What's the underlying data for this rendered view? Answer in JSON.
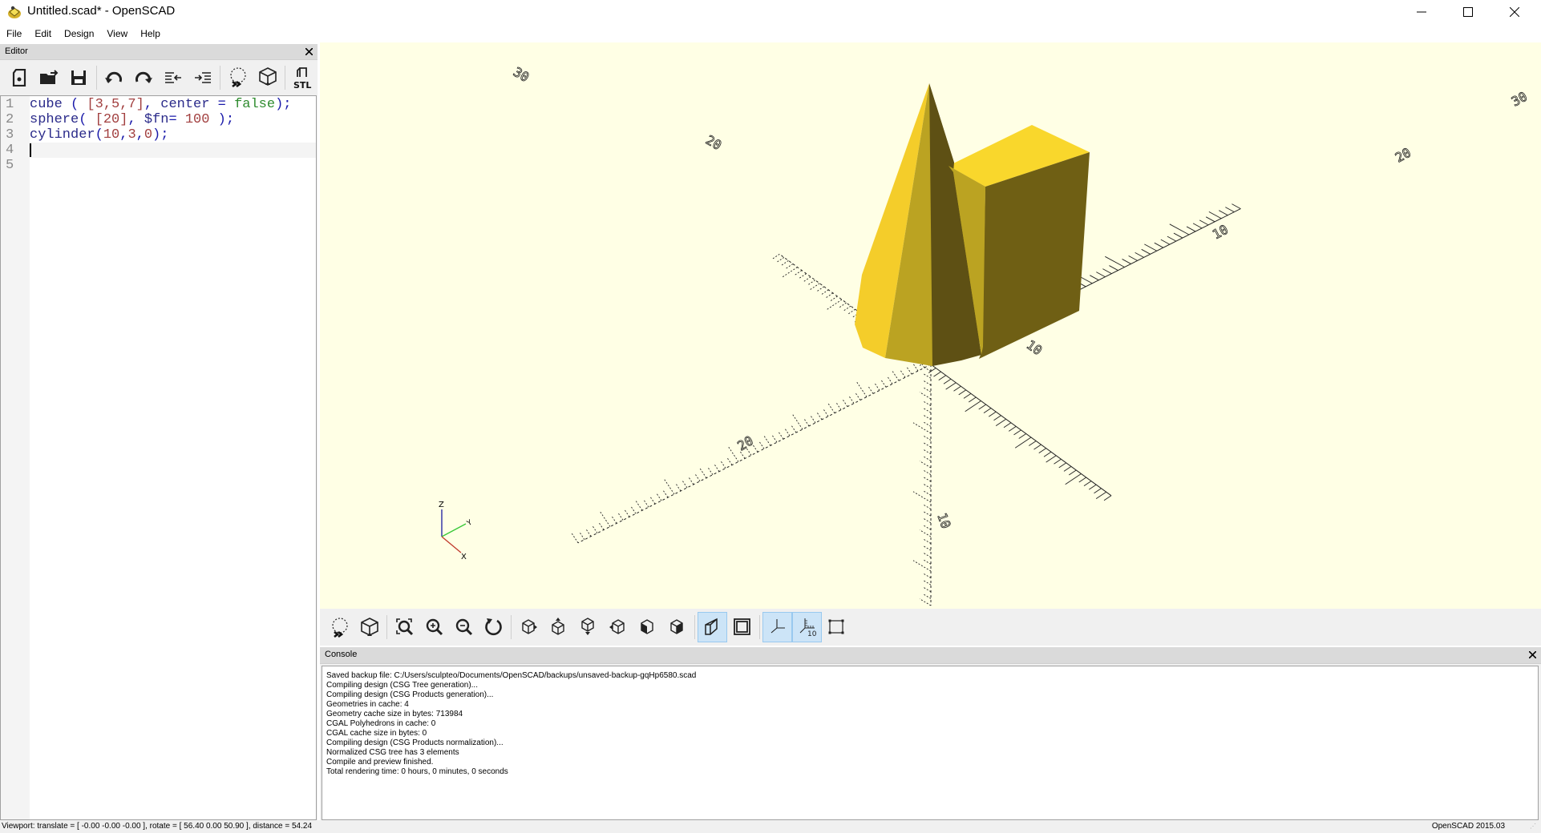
{
  "window": {
    "title": "Untitled.scad* - OpenSCAD",
    "controls": {
      "minimize": "minimize-icon",
      "maximize": "maximize-icon",
      "close": "close-icon"
    }
  },
  "menu": [
    "File",
    "Edit",
    "Design",
    "View",
    "Help"
  ],
  "editor": {
    "title": "Editor",
    "toolbar": [
      {
        "name": "new-file",
        "icon": "new-file-icon"
      },
      {
        "name": "open-file",
        "icon": "open-folder-icon"
      },
      {
        "name": "save-file",
        "icon": "save-icon"
      },
      {
        "name": "undo",
        "icon": "undo-icon"
      },
      {
        "name": "redo",
        "icon": "redo-icon"
      },
      {
        "name": "unindent",
        "icon": "unindent-icon"
      },
      {
        "name": "indent",
        "icon": "indent-icon"
      },
      {
        "name": "preview",
        "icon": "preview-icon"
      },
      {
        "name": "render",
        "icon": "render-icon"
      },
      {
        "name": "export-stl",
        "icon": "stl-export-icon",
        "label": "STL"
      }
    ],
    "lines": [
      {
        "n": "1",
        "tokens": [
          [
            "kw",
            "cube"
          ],
          [
            "punc",
            " ( "
          ],
          [
            "num",
            "[3,5,7]"
          ],
          [
            "punc",
            ", "
          ],
          [
            "kw",
            "center"
          ],
          [
            "punc",
            " = "
          ],
          [
            "bool",
            "false"
          ],
          [
            "punc",
            ");"
          ]
        ]
      },
      {
        "n": "2",
        "tokens": [
          [
            "kw",
            "sphere"
          ],
          [
            "punc",
            "( "
          ],
          [
            "num",
            "[20]"
          ],
          [
            "punc",
            ", "
          ],
          [
            "kw",
            "$fn"
          ],
          [
            "punc",
            "= "
          ],
          [
            "num",
            "100"
          ],
          [
            "punc",
            " );"
          ]
        ]
      },
      {
        "n": "3",
        "tokens": [
          [
            "kw",
            "cylinder"
          ],
          [
            "punc",
            "("
          ],
          [
            "num",
            "10"
          ],
          [
            "punc",
            ","
          ],
          [
            "num",
            "3"
          ],
          [
            "punc",
            ","
          ],
          [
            "num",
            "0"
          ],
          [
            "punc",
            ");"
          ]
        ]
      },
      {
        "n": "4",
        "tokens": []
      },
      {
        "n": "5",
        "tokens": []
      }
    ],
    "current_line": 4
  },
  "viewport": {
    "background": "#ffffe5",
    "object_colors": {
      "light": "#f9d72c",
      "mid": "#bba322",
      "dark": "#6f5f14",
      "darker": "#5e5014"
    },
    "axis_labels": [
      "30",
      "20",
      "10",
      "10",
      "20",
      "30",
      "10",
      "20",
      "10"
    ],
    "gizmo": {
      "x": "X",
      "y": "Y",
      "z": "Z"
    },
    "gizmo_colors": {
      "x": "#c0392b",
      "y": "#37c837",
      "z": "#1a1aa0"
    }
  },
  "view_toolbar": [
    {
      "name": "preview",
      "icon": "preview-icon",
      "active": false
    },
    {
      "name": "render",
      "icon": "render-icon",
      "active": false
    },
    {
      "name": "view-all",
      "icon": "zoom-fit-icon",
      "active": false
    },
    {
      "name": "zoom-in",
      "icon": "zoom-in-icon",
      "active": false
    },
    {
      "name": "zoom-out",
      "icon": "zoom-out-icon",
      "active": false
    },
    {
      "name": "reset-view",
      "icon": "reset-view-icon",
      "active": false
    },
    {
      "name": "view-right",
      "icon": "view-right-icon",
      "active": false
    },
    {
      "name": "view-top",
      "icon": "view-top-icon",
      "active": false
    },
    {
      "name": "view-bottom",
      "icon": "view-bottom-icon",
      "active": false
    },
    {
      "name": "view-left",
      "icon": "view-left-icon",
      "active": false
    },
    {
      "name": "view-front",
      "icon": "view-front-icon",
      "active": false
    },
    {
      "name": "view-back",
      "icon": "view-back-icon",
      "active": false
    },
    {
      "name": "perspective",
      "icon": "perspective-icon",
      "active": true
    },
    {
      "name": "orthogonal",
      "icon": "orthogonal-icon",
      "active": false
    },
    {
      "name": "show-axes",
      "icon": "axes-icon",
      "active": true
    },
    {
      "name": "show-scale-markers",
      "icon": "scale-markers-icon",
      "active": true,
      "label": "10"
    },
    {
      "name": "show-edges",
      "icon": "edges-icon",
      "active": false
    }
  ],
  "console": {
    "title": "Console",
    "lines": [
      "Saved backup file: C:/Users/sculpteo/Documents/OpenSCAD/backups/unsaved-backup-gqHp6580.scad",
      "Compiling design (CSG Tree generation)...",
      "Compiling design (CSG Products generation)...",
      "Geometries in cache: 4",
      "Geometry cache size in bytes: 713984",
      "CGAL Polyhedrons in cache: 0",
      "CGAL cache size in bytes: 0",
      "Compiling design (CSG Products normalization)...",
      "Normalized CSG tree has 3 elements",
      "Compile and preview finished.",
      "Total rendering time: 0 hours, 0 minutes, 0 seconds"
    ]
  },
  "status": {
    "viewport": "Viewport: translate = [ -0.00 -0.00 -0.00 ], rotate = [ 56.40 0.00 50.90 ], distance = 54.24",
    "version": "OpenSCAD 2015.03"
  }
}
